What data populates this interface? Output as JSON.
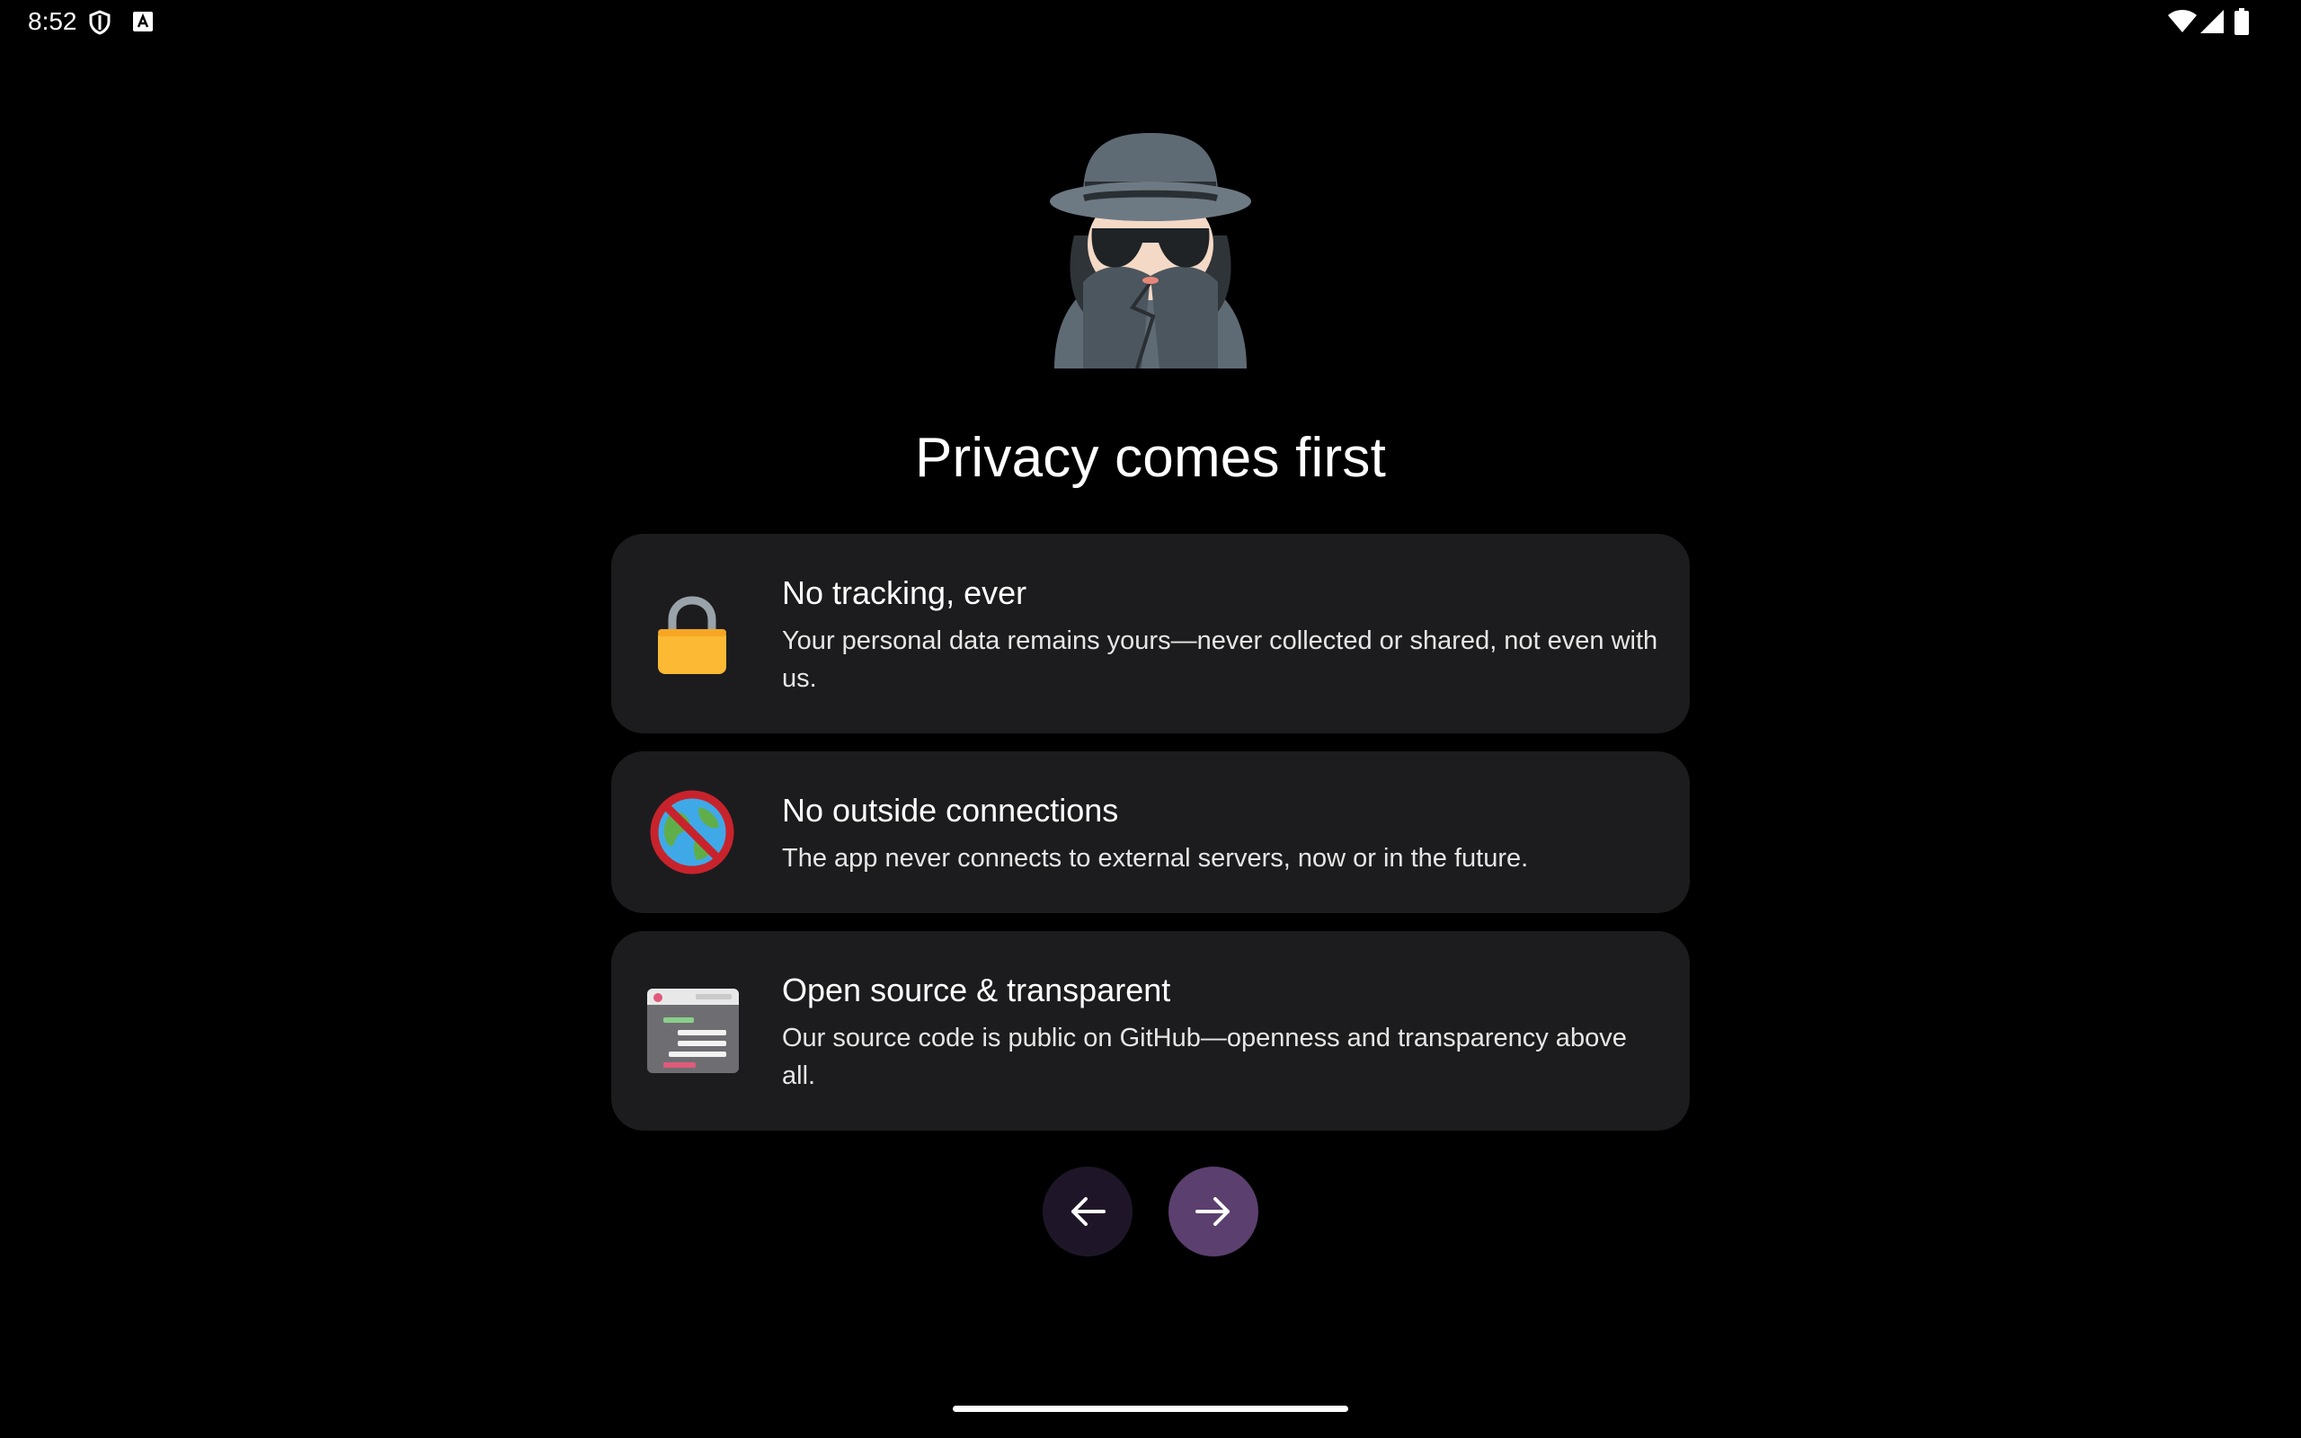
{
  "status_bar": {
    "time": "8:52",
    "icons": [
      "shield-icon",
      "text-a-icon",
      "wifi-icon",
      "cell-signal-icon",
      "battery-icon"
    ]
  },
  "hero": {
    "icon": "detective-icon"
  },
  "page": {
    "title": "Privacy comes first"
  },
  "cards": [
    {
      "icon": "lock-icon",
      "title": "No tracking, ever",
      "description": "Your personal data remains yours—never collected or shared, not even with us."
    },
    {
      "icon": "no-globe-icon",
      "title": "No outside connections",
      "description": "The app never connects to external servers, now or in the future."
    },
    {
      "icon": "source-code-icon",
      "title": "Open source & transparent",
      "description": "Our source code is public on GitHub—openness and transparency above all."
    }
  ],
  "navigation": {
    "back_icon": "arrow-left-icon",
    "next_icon": "arrow-right-icon"
  },
  "colors": {
    "background": "#000000",
    "card_background": "#1c1c1e",
    "back_button": "#1e1628",
    "next_button": "#5b3f6e"
  }
}
